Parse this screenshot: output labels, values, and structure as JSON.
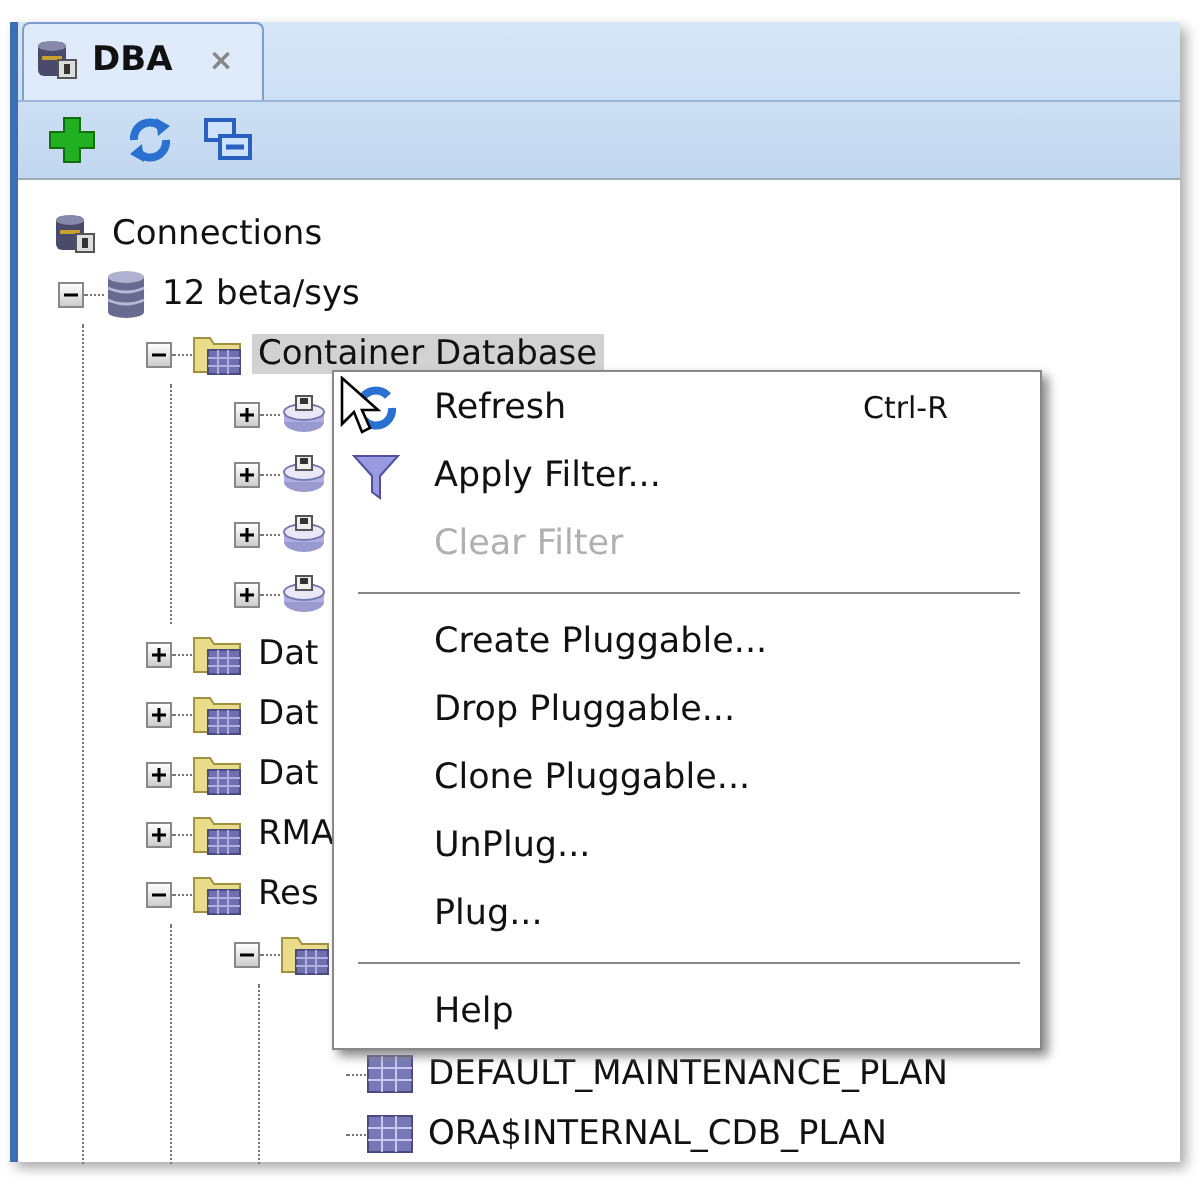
{
  "tabs": [
    {
      "label": "DBA",
      "selected": true,
      "close": "×"
    }
  ],
  "toolbar": [
    {
      "kind": "add"
    },
    {
      "kind": "refresh"
    },
    {
      "kind": "collapse"
    }
  ],
  "tree": {
    "label": "Connections",
    "kind": "connections",
    "children": [
      {
        "label": "12 beta/sys",
        "kind": "database",
        "expanded": true,
        "children": [
          {
            "label": "Container Database",
            "kind": "folder",
            "expanded": true,
            "selected": true,
            "children": [
              {
                "kind": "pluggable",
                "expanded": false
              },
              {
                "kind": "pluggable",
                "expanded": false
              },
              {
                "kind": "pluggable",
                "expanded": false
              },
              {
                "kind": "pluggable",
                "expanded": false
              }
            ]
          },
          {
            "label": "Dat",
            "kind": "folder",
            "expanded": false,
            "selected": false
          },
          {
            "label": "Dat",
            "kind": "folder",
            "expanded": false,
            "selected": false
          },
          {
            "label": "Dat",
            "kind": "folder",
            "expanded": false,
            "selected": false
          },
          {
            "label": "RMA",
            "kind": "folder",
            "expanded": false,
            "selected": false
          },
          {
            "label": "Res",
            "kind": "folder",
            "expanded": true,
            "selected": false,
            "children": [
              {
                "kind": "folder",
                "expanded": true,
                "children": [
                  {
                    "kind": "covered"
                  },
                  {
                    "label": "DEFAULT_MAINTENANCE_PLAN",
                    "kind": "plan"
                  },
                  {
                    "label": "ORA$INTERNAL_CDB_PLAN",
                    "kind": "plan"
                  }
                ]
              }
            ]
          }
        ]
      }
    ]
  },
  "context_menu": [
    {
      "kind": "refresh",
      "label": "Refresh",
      "shortcut": "Ctrl-R",
      "disabled": false
    },
    {
      "kind": "filter",
      "label": "Apply Filter...",
      "disabled": false
    },
    {
      "kind": "item",
      "label": "Clear Filter",
      "disabled": true
    },
    {
      "kind": "separator"
    },
    {
      "kind": "item",
      "label": "Create Pluggable...",
      "disabled": false
    },
    {
      "kind": "item",
      "label": "Drop Pluggable...",
      "disabled": false
    },
    {
      "kind": "item",
      "label": "Clone Pluggable...",
      "disabled": false
    },
    {
      "kind": "item",
      "label": "UnPlug...",
      "disabled": false
    },
    {
      "kind": "item",
      "label": "Plug...",
      "disabled": false
    },
    {
      "kind": "separator"
    },
    {
      "kind": "item",
      "label": "Help",
      "disabled": false
    }
  ]
}
